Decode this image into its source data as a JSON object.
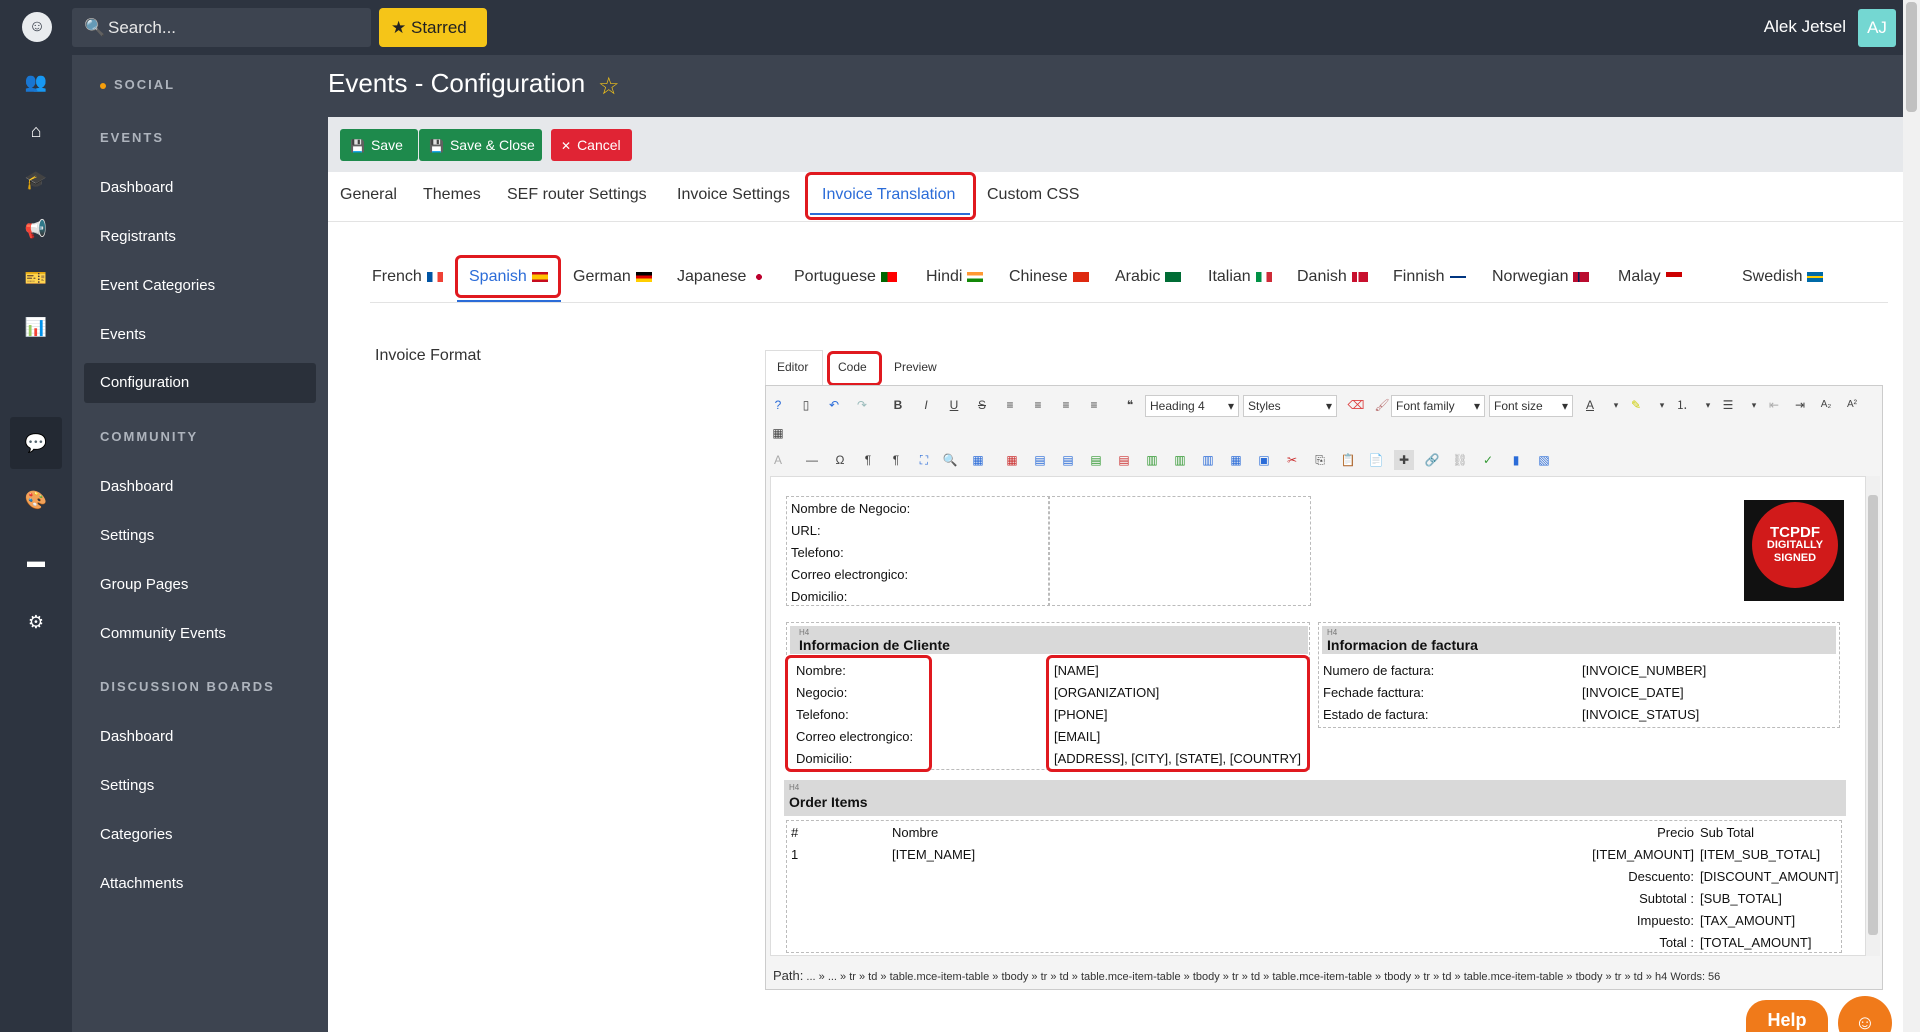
{
  "topbar": {
    "search_placeholder": "Search...",
    "starred_label": "Starred",
    "user_name": "Alek Jetsel",
    "user_initials": "AJ"
  },
  "rail_icons": [
    "users-icon",
    "sitemap-icon",
    "graduation-cap-icon",
    "megaphone-icon",
    "ticket-icon",
    "chart-icon",
    "chat-icon",
    "palette-icon",
    "calendar-icon",
    "gear-icon"
  ],
  "sidebar": {
    "social": "SOCIAL",
    "events_section": "EVENTS",
    "events_items": [
      "Dashboard",
      "Registrants",
      "Event Categories",
      "Events",
      "Configuration"
    ],
    "community_section": "COMMUNITY",
    "community_items": [
      "Dashboard",
      "Settings",
      "Group Pages",
      "Community Events"
    ],
    "discussion_section": "DISCUSSION BOARDS",
    "discussion_items": [
      "Dashboard",
      "Settings",
      "Categories",
      "Attachments"
    ]
  },
  "page": {
    "title": "Events - Configuration"
  },
  "actions": {
    "save": "Save",
    "save_close": "Save & Close",
    "cancel": "Cancel"
  },
  "tabs": [
    "General",
    "Themes",
    "SEF router Settings",
    "Invoice Settings",
    "Invoice Translation",
    "Custom CSS"
  ],
  "active_tab": "Invoice Translation",
  "languages": [
    "French",
    "Spanish",
    "German",
    "Japanese",
    "Portuguese",
    "Hindi",
    "Chinese",
    "Arabic",
    "Italian",
    "Danish",
    "Finnish",
    "Norwegian",
    "Malay",
    "Swedish"
  ],
  "active_language": "Spanish",
  "field_label": "Invoice Format",
  "editor": {
    "tabs": [
      "Editor",
      "Code",
      "Preview"
    ],
    "block_format": "Heading 4",
    "styles": "Styles",
    "font_family": "Font family",
    "font_size": "Font size",
    "path_label": "Path:",
    "path": "... » ... » tr » td » table.mce-item-table » tbody » tr » td » table.mce-item-table » tbody » tr » td » table.mce-item-table » tbody » tr » td » table.mce-item-table » tbody » tr » td » h4",
    "words": "Words: 56"
  },
  "document": {
    "business_labels": [
      "Nombre de Negocio:",
      "URL:",
      "Telefono:",
      "Correo electrongico:",
      "Domicilio:"
    ],
    "h4_tag": "H4",
    "client_heading": "Informacion de Cliente",
    "client_labels": [
      "Nombre:",
      "Negocio:",
      "Telefono:",
      "Correo electrongico:",
      "Domicilio:"
    ],
    "client_values": [
      "[NAME]",
      "[ORGANIZATION]",
      "[PHONE]",
      "[EMAIL]",
      "[ADDRESS], [CITY], [STATE], [COUNTRY]"
    ],
    "invoice_heading": "Informacion de factura",
    "invoice_labels": [
      "Numero de factura:",
      "Fechade facttura:",
      "Estado de factura:"
    ],
    "invoice_values": [
      "[INVOICE_NUMBER]",
      "[INVOICE_DATE]",
      "[INVOICE_STATUS]"
    ],
    "order_heading": "Order Items",
    "order_headers": [
      "#",
      "Nombre",
      "Precio",
      "Sub Total"
    ],
    "order_row": [
      "1",
      "[ITEM_NAME]",
      "[ITEM_AMOUNT]",
      "[ITEM_SUB_TOTAL]"
    ],
    "totals_labels": [
      "Descuento:",
      "Subtotal :",
      "Impuesto:",
      "Total :"
    ],
    "totals_values": [
      "[DISCOUNT_AMOUNT]",
      "[SUB_TOTAL]",
      "[TAX_AMOUNT]",
      "[TOTAL_AMOUNT]"
    ],
    "logo_text_1": "TCPDF",
    "logo_text_2": "DIGITALLY",
    "logo_text_3": "SIGNED"
  },
  "help_label": "Help",
  "colors": {
    "accent": "#2b6cd8",
    "highlight_box": "#e0191f",
    "save_green": "#1e8a4c",
    "cancel_red": "#e02434",
    "starred_yellow": "#f5c518",
    "help_orange": "#f07a1a"
  }
}
